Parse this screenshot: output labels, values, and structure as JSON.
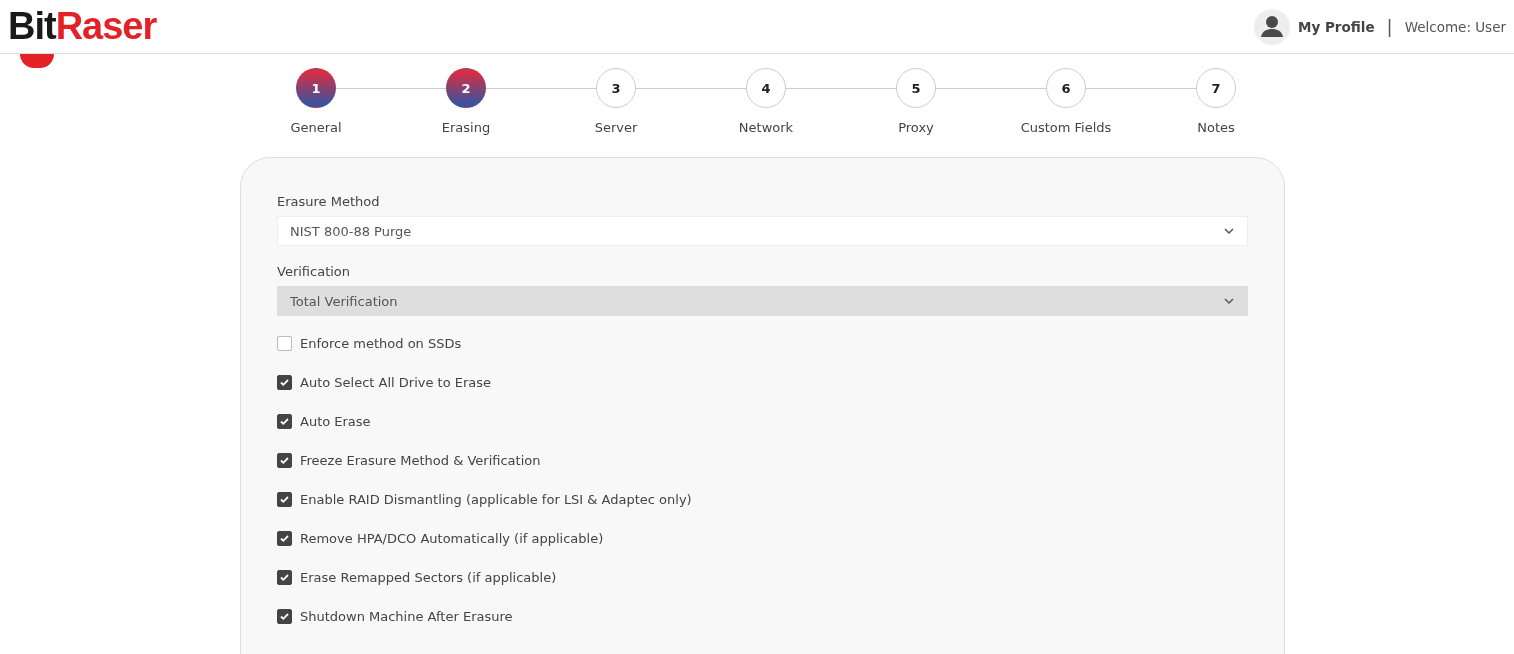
{
  "header": {
    "logo": {
      "dark": "Bit",
      "red": "Raser"
    },
    "profile_link": "My Profile",
    "separator": "|",
    "welcome": "Welcome: User"
  },
  "steps": [
    {
      "number": "1",
      "label": "General",
      "completed": true
    },
    {
      "number": "2",
      "label": "Erasing",
      "completed": true
    },
    {
      "number": "3",
      "label": "Server",
      "completed": false
    },
    {
      "number": "4",
      "label": "Network",
      "completed": false
    },
    {
      "number": "5",
      "label": "Proxy",
      "completed": false
    },
    {
      "number": "6",
      "label": "Custom Fields",
      "completed": false
    },
    {
      "number": "7",
      "label": "Notes",
      "completed": false
    }
  ],
  "fields": [
    {
      "label": "Erasure Method",
      "value": "NIST 800-88 Purge",
      "disabled": false
    },
    {
      "label": "Verification",
      "value": "Total Verification",
      "disabled": true
    }
  ],
  "options": [
    {
      "label": "Enforce method on SSDs",
      "checked": false
    },
    {
      "label": "Auto Select All Drive to Erase",
      "checked": true
    },
    {
      "label": "Auto Erase",
      "checked": true
    },
    {
      "label": "Freeze Erasure Method & Verification",
      "checked": true
    },
    {
      "label": "Enable RAID Dismantling (applicable for LSI & Adaptec only)",
      "checked": true
    },
    {
      "label": "Remove HPA/DCO Automatically (if applicable)",
      "checked": true
    },
    {
      "label": "Erase Remapped Sectors (if applicable)",
      "checked": true
    },
    {
      "label": "Shutdown Machine After Erasure",
      "checked": true
    }
  ]
}
